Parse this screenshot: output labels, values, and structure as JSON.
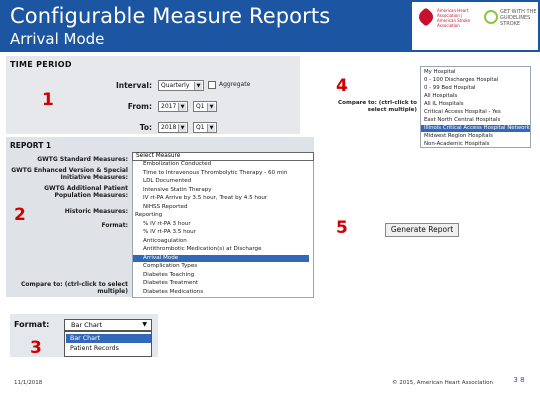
{
  "header": {
    "title": "Configurable Measure Reports",
    "subtitle": "Arrival Mode",
    "logos": {
      "aha_lines": "American Heart Association | American Stroke Association",
      "gwtg_lines": "GET WITH THE GUIDELINES STROKE"
    }
  },
  "time_period": {
    "title": "TIME PERIOD",
    "interval_label": "Interval:",
    "interval_value": "Quarterly",
    "aggregate_label": "Aggregate",
    "from_label": "From:",
    "from_year": "2017",
    "from_quarter": "Q1",
    "to_label": "To:",
    "to_year": "2018",
    "to_quarter": "Q1"
  },
  "report": {
    "title": "REPORT 1",
    "labels": {
      "standard": "GWTG Standard Measures:",
      "enhanced": "GWTG Enhanced Version & Special Initiative Measures:",
      "additional": "GWTG Additional Patient Population Measures:",
      "historic": "Historic Measures:",
      "format": "Format:",
      "compare": "Compare to: (ctrl-click to select multiple)"
    },
    "measure_header": "Select Measure",
    "measures": [
      {
        "label": "Embolization Conducted",
        "group": false,
        "selected": false
      },
      {
        "label": "Time to Intravenous Thrombolytic Therapy - 60 min",
        "group": false,
        "selected": false
      },
      {
        "label": "LDL Documented",
        "group": false,
        "selected": false
      },
      {
        "label": "Intensive Statin Therapy",
        "group": false,
        "selected": false
      },
      {
        "label": "IV rt-PA Arrive by 3.5 hour, Treat by 4.5 hour",
        "group": false,
        "selected": false
      },
      {
        "label": "NIHSS Reported",
        "group": false,
        "selected": false
      },
      {
        "label": "Reporting",
        "group": true,
        "selected": false
      },
      {
        "label": "% IV rt-PA 3 hour",
        "group": false,
        "selected": false
      },
      {
        "label": "% IV rt-PA 3.5 hour",
        "group": false,
        "selected": false
      },
      {
        "label": "Anticoagulation",
        "group": false,
        "selected": false
      },
      {
        "label": "Antithrombotic Medication(s) at Discharge",
        "group": false,
        "selected": false
      },
      {
        "label": "Arrival Mode",
        "group": false,
        "selected": true
      },
      {
        "label": "Complication Types",
        "group": false,
        "selected": false
      },
      {
        "label": "Diabetes Teaching",
        "group": false,
        "selected": false
      },
      {
        "label": "Diabetes Treatment",
        "group": false,
        "selected": false
      },
      {
        "label": "Diabetes Medications",
        "group": false,
        "selected": false
      }
    ],
    "compare_options": [
      {
        "label": "My Hospital",
        "selected": false
      },
      {
        "label": "0 - 100 Discharges Hospital",
        "selected": false
      },
      {
        "label": "0 - 99 Bed Hospital",
        "selected": false
      },
      {
        "label": "All Hospitals",
        "selected": false
      },
      {
        "label": "All IL Hospitals",
        "selected": false
      },
      {
        "label": "Critical Access Hospital - Yes",
        "selected": false
      },
      {
        "label": "East North Central Hospitals",
        "selected": false
      },
      {
        "label": "Illinois Critical Access Hospital Network",
        "selected": true
      },
      {
        "label": "Midwest Region Hospitals",
        "selected": false
      },
      {
        "label": "Non-Academic Hospitals",
        "selected": false
      }
    ],
    "generate_button": "Generate Report"
  },
  "format_panel": {
    "label": "Format:",
    "selected": "Bar Chart",
    "options": [
      {
        "label": "Bar Chart",
        "selected": true
      },
      {
        "label": "Patient Records",
        "selected": false
      }
    ]
  },
  "callouts": {
    "one": "1",
    "two": "2",
    "three": "3",
    "four": "4",
    "five": "5"
  },
  "footer": {
    "date": "11/1/2018",
    "copyright": "© 2015, American Heart Association",
    "slide_number": "3 8"
  },
  "colors": {
    "header_blue": "#1c56a3",
    "callout_red": "#d10000",
    "selection_blue": "#3368b8"
  }
}
